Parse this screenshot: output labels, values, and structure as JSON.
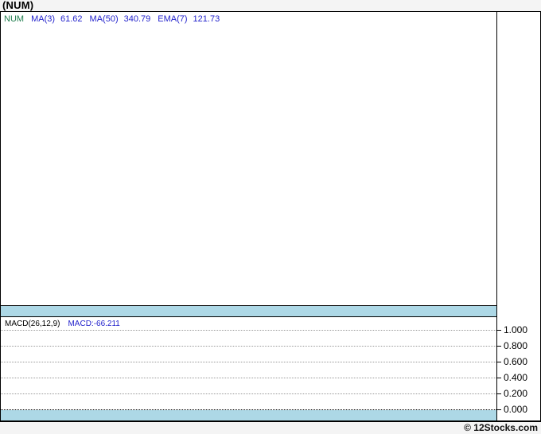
{
  "title": "(NUM)",
  "main_chart": {
    "legend": {
      "symbol": "NUM",
      "items": [
        {
          "label": "MA(3)",
          "value": "61.62"
        },
        {
          "label": "MA(50)",
          "value": "340.79"
        },
        {
          "label": "EMA(7)",
          "value": "121.73"
        }
      ]
    }
  },
  "macd_panel": {
    "legend_label": "MACD(26,12,9)",
    "legend_value": "MACD:-66.211",
    "axis_ticks": [
      "1.000",
      "0.800",
      "0.600",
      "0.400",
      "0.200",
      "0.000"
    ]
  },
  "footer": {
    "credit": "© 12Stocks.com"
  },
  "colors": {
    "symbol_text": "#1f7d4d",
    "indicator_text": "#2222cc",
    "macd_label_text": "#000000",
    "macd_value_text": "#2222cc",
    "separator_bar": "#add8e6",
    "grid_dotted": "#999999",
    "panel_border": "#000000",
    "page_background": "#f4f4f4",
    "panel_background": "#ffffff"
  },
  "chart_data": [
    {
      "type": "line",
      "title": "NUM price panel",
      "series": [
        {
          "name": "NUM"
        },
        {
          "name": "MA(3)",
          "current": 61.62
        },
        {
          "name": "MA(50)",
          "current": 340.79
        },
        {
          "name": "EMA(7)",
          "current": 121.73
        }
      ],
      "grid": false,
      "legend_position": "top-left",
      "note": "price plot area renders empty (no visible data points)"
    },
    {
      "type": "line",
      "title": "MACD(26,12,9)",
      "series": [
        {
          "name": "MACD",
          "current": -66.211
        }
      ],
      "yticks": [
        1.0,
        0.8,
        0.6,
        0.4,
        0.2,
        0.0
      ],
      "ylim": [
        0.0,
        1.15
      ],
      "grid": true,
      "legend_position": "top-left",
      "note": "MACD panel renders empty; current value -66.211 is off the visible 0.000–1.000 scale"
    }
  ]
}
